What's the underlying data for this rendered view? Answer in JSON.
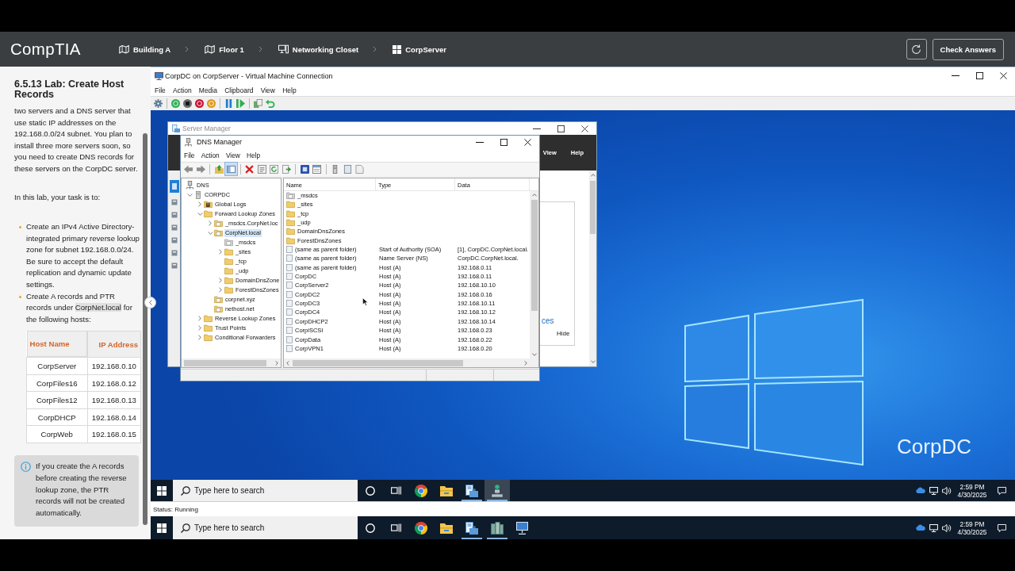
{
  "header": {
    "logo": "CompTIA",
    "breadcrumbs": [
      {
        "kind": "map",
        "label": "Building A"
      },
      {
        "kind": "map",
        "label": "Floor 1"
      },
      {
        "kind": "computer",
        "label": "Networking Closet"
      },
      {
        "kind": "tiles",
        "label": "CorpServer"
      }
    ],
    "check_button": "Check Answers"
  },
  "lab": {
    "title": "6.5.13 Lab: Create Host Records",
    "intro": "two servers and a DNS server that use static IP addresses on the 192.168.0.0/24 subnet. You plan to install three more servers soon, so you need to create DNS records for these servers on the CorpDC server.",
    "task_lead": "In this lab, your task is to:",
    "tasks": [
      {
        "text": "Create an IPv4 Active Directory-integrated primary reverse lookup zone for subnet 192.168.0.0/24. Be sure to accept the default replication and dynamic update settings."
      },
      {
        "text": "Create A records and PTR records under ",
        "highlight": "CorpNet.local",
        "after": " for the following hosts:"
      }
    ],
    "table": {
      "columns": [
        "Host Name",
        "IP Address"
      ],
      "rows": [
        [
          "CorpServer",
          "192.168.0.10"
        ],
        [
          "CorpFiles16",
          "192.168.0.12"
        ],
        [
          "CorpFiles12",
          "192.168.0.13"
        ],
        [
          "CorpDHCP",
          "192.168.0.14"
        ],
        [
          "CorpWeb",
          "192.168.0.15"
        ]
      ]
    },
    "note": "If you create the A records before creating the reverse lookup zone, the PTR records will not be created automatically."
  },
  "vm_window": {
    "title": "CorpDC on CorpServer - Virtual Machine Connection",
    "menu": [
      "File",
      "Action",
      "Media",
      "Clipboard",
      "View",
      "Help"
    ],
    "status": "Status: Running"
  },
  "desktop": {
    "label": "CorpDC"
  },
  "server_manager": {
    "title": "Server Manager",
    "menu": [
      "View",
      "Help"
    ],
    "link": "ces",
    "hide_button": "Hide"
  },
  "dns_manager": {
    "title": "DNS Manager",
    "menu": [
      "File",
      "Action",
      "View",
      "Help"
    ],
    "console_tree_pressed": true,
    "tree": [
      {
        "label": "DNS",
        "kind": "dns",
        "selected": false,
        "children": [
          {
            "label": "CORPDC",
            "kind": "server",
            "expanded": true,
            "selected": false,
            "children": [
              {
                "label": "Global Logs",
                "kind": "logs",
                "expanded": false,
                "selected": false
              },
              {
                "label": "Forward Lookup Zones",
                "kind": "folder",
                "expanded": true,
                "selected": false,
                "children": [
                  {
                    "label": "_msdcs.CorpNet.loc",
                    "kind": "zone",
                    "expanded": false,
                    "selected": false
                  },
                  {
                    "label": "CorpNet.local",
                    "kind": "zone",
                    "expanded": true,
                    "selected": true,
                    "children": [
                      {
                        "label": "_msdcs",
                        "kind": "delegation",
                        "selected": false
                      },
                      {
                        "label": "_sites",
                        "kind": "folder",
                        "expanded": false,
                        "selected": false
                      },
                      {
                        "label": "_tcp",
                        "kind": "folder",
                        "selected": false
                      },
                      {
                        "label": "_udp",
                        "kind": "folder",
                        "selected": false
                      },
                      {
                        "label": "DomainDnsZone",
                        "kind": "folder",
                        "expanded": false,
                        "selected": false
                      },
                      {
                        "label": "ForestDnsZones",
                        "kind": "folder",
                        "expanded": false,
                        "selected": false
                      }
                    ]
                  },
                  {
                    "label": "corpnet.xyz",
                    "kind": "zone",
                    "selected": false
                  },
                  {
                    "label": "nethost.net",
                    "kind": "zone",
                    "selected": false
                  }
                ]
              },
              {
                "label": "Reverse Lookup Zones",
                "kind": "folder",
                "expanded": false,
                "selected": false
              },
              {
                "label": "Trust Points",
                "kind": "folder",
                "expanded": false,
                "selected": false
              },
              {
                "label": "Conditional Forwarders",
                "kind": "folder",
                "expanded": false,
                "selected": false
              }
            ]
          }
        ]
      }
    ],
    "columns": [
      "Name",
      "Type",
      "Data"
    ],
    "rows": [
      {
        "kind": "delegation",
        "name": "_msdcs"
      },
      {
        "kind": "folder",
        "name": "_sites"
      },
      {
        "kind": "folder",
        "name": "_tcp"
      },
      {
        "kind": "folder",
        "name": "_udp"
      },
      {
        "kind": "folder",
        "name": "DomainDnsZones"
      },
      {
        "kind": "folder",
        "name": "ForestDnsZones"
      },
      {
        "kind": "record",
        "name": "(same as parent folder)",
        "type": "Start of Authority (SOA)",
        "data": "[1], CorpDC.CorpNet.local."
      },
      {
        "kind": "record",
        "name": "(same as parent folder)",
        "type": "Name Server (NS)",
        "data": "CorpDC.CorpNet.local."
      },
      {
        "kind": "record",
        "name": "(same as parent folder)",
        "type": "Host (A)",
        "data": "192.168.0.11"
      },
      {
        "kind": "record",
        "name": "CorpDC",
        "type": "Host (A)",
        "data": "192.168.0.11"
      },
      {
        "kind": "record",
        "name": "CorpServer2",
        "type": "Host (A)",
        "data": "192.168.10.10"
      },
      {
        "kind": "record",
        "name": "CorpDC2",
        "type": "Host (A)",
        "data": "192.168.0.16"
      },
      {
        "kind": "record",
        "name": "CorpDC3",
        "type": "Host (A)",
        "data": "192.168.10.11"
      },
      {
        "kind": "record",
        "name": "CorpDC4",
        "type": "Host (A)",
        "data": "192.168.10.12"
      },
      {
        "kind": "record",
        "name": "CorpDHCP2",
        "type": "Host (A)",
        "data": "192.168.10.14"
      },
      {
        "kind": "record",
        "name": "CorpiSCSI",
        "type": "Host (A)",
        "data": "192.168.0.23"
      },
      {
        "kind": "record",
        "name": "CorpData",
        "type": "Host (A)",
        "data": "192.168.0.22"
      },
      {
        "kind": "record",
        "name": "CorpVPN1",
        "type": "Host (A)",
        "data": "192.168.0.20"
      }
    ]
  },
  "vm_taskbar": {
    "search": {
      "placeholder": "Type here to search"
    },
    "apps": [
      {
        "kind": "circle",
        "selected": false,
        "running": false
      },
      {
        "kind": "task-view",
        "selected": false,
        "running": false
      },
      {
        "kind": "browser",
        "selected": false,
        "running": false
      },
      {
        "kind": "files",
        "selected": false,
        "running": false
      },
      {
        "kind": "toolbox",
        "selected": false,
        "running": true
      },
      {
        "kind": "dns",
        "selected": true,
        "running": true
      }
    ],
    "clock": {
      "time": "2:59 PM",
      "date": "4/30/2025"
    }
  },
  "host_taskbar": {
    "search": {
      "placeholder": "Type here to search"
    },
    "apps": [
      {
        "kind": "circle",
        "selected": false,
        "running": false
      },
      {
        "kind": "task-view",
        "selected": false,
        "running": false
      },
      {
        "kind": "browser",
        "selected": false,
        "running": false
      },
      {
        "kind": "files",
        "selected": false,
        "running": false
      },
      {
        "kind": "toolbox",
        "selected": false,
        "running": true
      },
      {
        "kind": "servers",
        "selected": false,
        "running": true
      },
      {
        "kind": "monitor",
        "selected": false,
        "running": false
      }
    ],
    "clock": {
      "time": "2:59 PM",
      "date": "4/30/2025"
    }
  }
}
